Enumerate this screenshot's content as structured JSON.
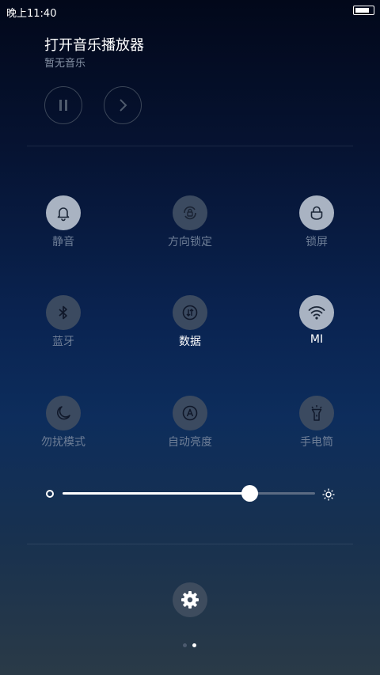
{
  "status_bar": {
    "time": "晚上11:40",
    "battery_level_percent": 85
  },
  "music": {
    "title": "打开音乐播放器",
    "subtitle": "暂无音乐"
  },
  "toggles": [
    {
      "label": "静音",
      "icon": "bell-icon",
      "state": "on"
    },
    {
      "label": "方向锁定",
      "icon": "rotation-lock-icon",
      "state": "off"
    },
    {
      "label": "锁屏",
      "icon": "lock-icon",
      "state": "on"
    },
    {
      "label": "蓝牙",
      "icon": "bluetooth-icon",
      "state": "off"
    },
    {
      "label": "数据",
      "icon": "mobile-data-icon",
      "state": "off"
    },
    {
      "label": "MI",
      "icon": "wifi-icon",
      "state": "on"
    },
    {
      "label": "勿扰模式",
      "icon": "moon-icon",
      "state": "off"
    },
    {
      "label": "自动亮度",
      "icon": "auto-brightness-icon",
      "state": "off"
    },
    {
      "label": "手电筒",
      "icon": "flashlight-icon",
      "state": "off"
    }
  ],
  "brightness": {
    "level_fraction": 0.74
  },
  "pager": {
    "total": 2,
    "active_index": 1
  },
  "colors": {
    "tile_active": "#a9b3c2",
    "tile_inactive": "#3b4a60",
    "label_dim": "#6f7f97",
    "label_bright": "#ffffff"
  }
}
